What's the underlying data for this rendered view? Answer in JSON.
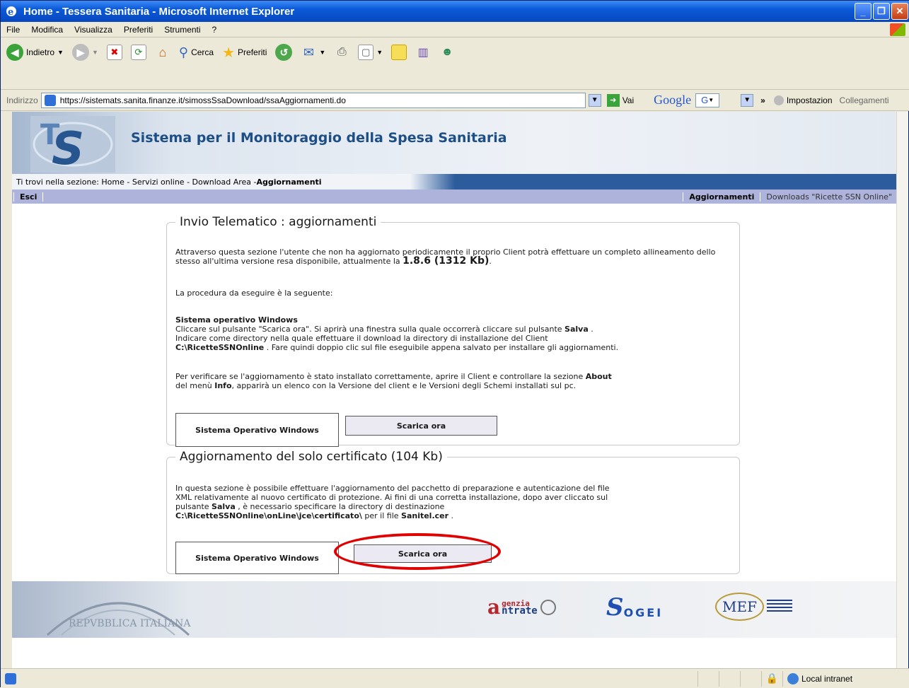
{
  "window": {
    "title": "Home - Tessera Sanitaria - Microsoft Internet Explorer"
  },
  "menu": [
    "File",
    "Modifica",
    "Visualizza",
    "Preferiti",
    "Strumenti",
    "?"
  ],
  "toolbar": {
    "back_label": "Indietro",
    "search_label": "Cerca",
    "favorites_label": "Preferiti"
  },
  "address": {
    "label": "Indirizzo",
    "url": "https://sistemats.sanita.finanze.it/simossSsaDownload/ssaAggiornamenti.do",
    "go_label": "Vai",
    "google_label": "Google",
    "google_box": "G",
    "chevron": "»",
    "settings_label": "Impostazion",
    "links_label": "Collegamenti"
  },
  "banner": {
    "title": "Sistema per il Monitoraggio della Spesa Sanitaria"
  },
  "breadcrumb": {
    "prefix": "Ti trovi nella sezione: Home - Servizi online - Download Area - ",
    "current": "Aggiornamenti"
  },
  "nav": {
    "exit": "Esci",
    "updates": "Aggiornamenti",
    "downloads": "Downloads \"Ricette SSN Online\""
  },
  "section1": {
    "legend": "Invio Telematico : aggiornamenti",
    "intro": "Attraverso questa sezione l'utente che non ha aggiornato periodicamente il proprio Client potrà effettuare un completo allineamento dello stesso all'ultima versione resa disponibile, attualmente la ",
    "version": "1.8.6 (1312 Kb)",
    "intro_end": ".",
    "procedure": "La procedura da eseguire è la seguente:",
    "os_heading": "Sistema operativo Windows",
    "step_a": "Cliccare sul pulsante \"Scarica ora\". Si aprirà una finestra sulla quale occorrerà cliccare sul pulsante ",
    "step_a_bold": "Salva",
    "step_a_end": " .",
    "step_b": "Indicare come directory nella quale effettuare il download la directory di installazione del Client",
    "step_c_bold": "C:\\RicetteSSNOnline",
    "step_c": " . Fare quindi doppio clic sul file eseguibile appena salvato per installare gli aggiornamenti.",
    "verify_a": "Per verificare se l'aggiornamento è stato installato correttamente, aprire il Client e controllare la sezione ",
    "verify_about": "About",
    "verify_b": "del menù ",
    "verify_info": "Info",
    "verify_c": ", apparirà un elenco con la Versione del client e le Versioni degli Schemi installati sul pc.",
    "os_label": "Sistema Operativo Windows",
    "download_label": "Scarica ora"
  },
  "section2": {
    "legend": "Aggiornamento del solo certificato (104 Kb)",
    "line1": "In questa sezione è possibile effettuare l'aggiornamento del pacchetto di preparazione e autenticazione del file",
    "line2": "XML relativamente al nuovo certificato di protezione. Ai fini di una corretta installazione, dopo aver cliccato sul",
    "line3a": "pulsante ",
    "line3_bold": "Salva",
    "line3b": " , è necessario specificare la directory di destinazione",
    "line4_bold": "C:\\RicetteSSNOnline\\onLine\\jce\\certificato\\",
    "line4a": " per il file ",
    "line4_file": "Sanitel.cer",
    "line4_end": " .",
    "os_label": "Sistema Operativo Windows",
    "download_label": "Scarica ora"
  },
  "footer": {
    "agenzia_top": "genzia",
    "agenzia_bottom": "ntrate",
    "sogei": "OGEI",
    "mef": "MEF",
    "seal_text": "REPVBBLICA ITALIANA"
  },
  "status": {
    "zone": "Local intranet"
  },
  "colors": {
    "highlight": "#e10000",
    "banner_title": "#1d4f86",
    "nav_bg": "#aeb3dc"
  }
}
